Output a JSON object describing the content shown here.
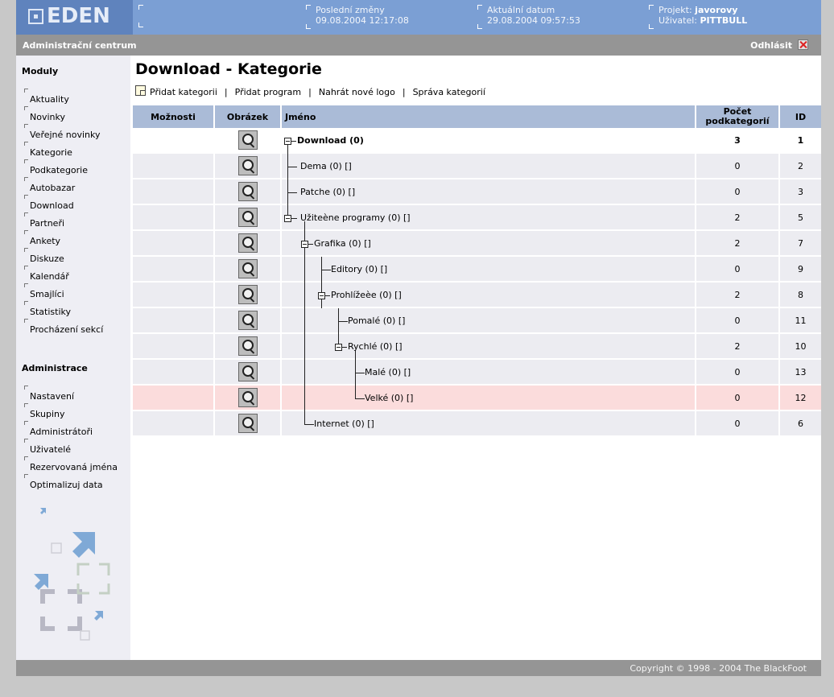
{
  "header": {
    "logo": "EDEN",
    "last_change_label": "Poslední změny",
    "last_change_value": "09.08.2004 12:17:08",
    "current_date_label": "Aktuální datum",
    "current_date_value": "29.08.2004 09:57:53",
    "project_label": "Projekt:",
    "project_value": "javorovy",
    "user_label": "Uživatel:",
    "user_value": "PITTBULL"
  },
  "adminbar": {
    "title": "Administrační centrum",
    "logout": "Odhlásit"
  },
  "sidebar": {
    "modules_title": "Moduly",
    "modules": [
      "Aktuality",
      "Novinky",
      "Veřejné novinky",
      "Kategorie",
      "Podkategorie",
      "Autobazar",
      "Download",
      "Partneři",
      "Ankety",
      "Diskuze",
      "Kalendář",
      "Smajlíci",
      "Statistiky",
      "Procházení sekcí"
    ],
    "admin_title": "Administrace",
    "admin": [
      "Nastavení",
      "Skupiny",
      "Administrátoři",
      "Uživatelé",
      "Rezervovaná jména",
      "Optimalizuj data"
    ]
  },
  "main": {
    "title": "Download - Kategorie",
    "actions": [
      "Přidat kategorii",
      "Přidat program",
      "Nahrát nové logo",
      "Správa kategorií"
    ],
    "columns": {
      "options": "Možnosti",
      "image": "Obrázek",
      "name": "Jméno",
      "count_line1": "Počet",
      "count_line2": "podkategorií",
      "id": "ID"
    },
    "rows": [
      {
        "name": "Download (0)",
        "count": "3",
        "id": "1"
      },
      {
        "name": "Dema (0) []",
        "count": "0",
        "id": "2"
      },
      {
        "name": "Patche (0) []",
        "count": "0",
        "id": "3"
      },
      {
        "name": "Užiteène programy (0) []",
        "count": "2",
        "id": "5"
      },
      {
        "name": "Grafika (0) []",
        "count": "2",
        "id": "7"
      },
      {
        "name": "Editory (0) []",
        "count": "0",
        "id": "9"
      },
      {
        "name": "Prohlížeèe (0) []",
        "count": "2",
        "id": "8"
      },
      {
        "name": "Pomalé (0) []",
        "count": "0",
        "id": "11"
      },
      {
        "name": "Rychlé (0) []",
        "count": "2",
        "id": "10"
      },
      {
        "name": "Malé (0) []",
        "count": "0",
        "id": "13"
      },
      {
        "name": "Velké (0) []",
        "count": "0",
        "id": "12"
      },
      {
        "name": "Internet (0) []",
        "count": "0",
        "id": "6"
      }
    ]
  },
  "footer": {
    "copyright": "Copyright © 1998 - 2004 The BlackFoot"
  },
  "colors": {
    "header_blue": "#7b9fd4",
    "logo_blue": "#5f83bd",
    "bar_gray": "#959595",
    "table_header": "#aabbd7",
    "row_bg": "#ececf1",
    "row_highlight": "#fbdcdc",
    "sidebar_bg": "#eeeef4"
  }
}
